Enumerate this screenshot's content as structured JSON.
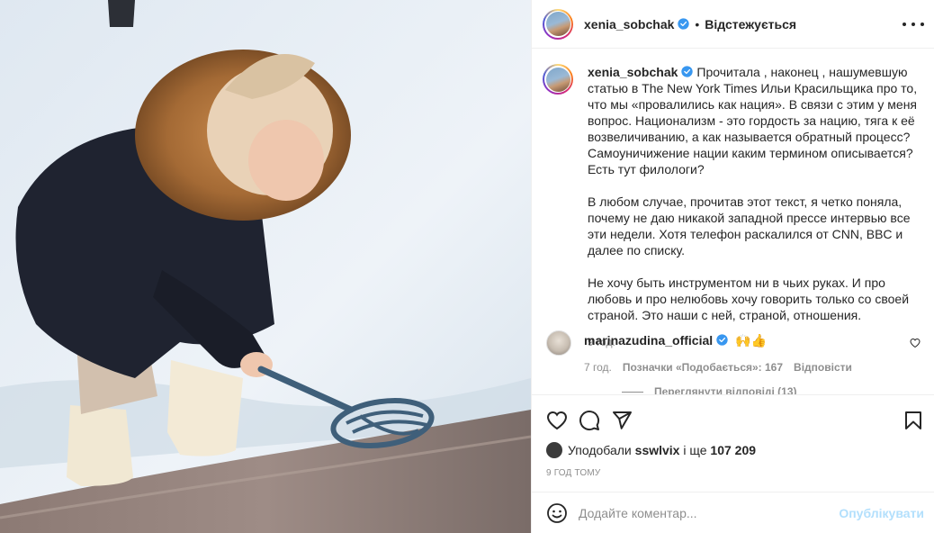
{
  "header": {
    "username": "xenia_sobchak",
    "separator": "•",
    "follow_state": "Відстежується"
  },
  "caption": {
    "username": "xenia_sobchak",
    "paragraph_1": "Прочитала , наконец , нашумевшую статью в The New York Times Ильи Красильщика про то, что мы «провалились как нация». В связи с этим у меня вопрос. Национализм - это гордость за нацию, тяга к её возвеличиванию, а как называется обратный процесс? Самоуничижение нации каким термином описывается? Есть тут филологи?",
    "paragraph_2": "В любом случае, прочитав этот текст, я четко поняла, почему не даю никакой западной прессе интервью все эти недели. Хотя телефон раскалился от CNN, BBC и далее по списку.",
    "paragraph_3": "Не хочу быть инструментом ни в чьих руках. И про любовь и про нелюбовь хочу говорить только со своей страной. Это наши с ней, страной, отношения.",
    "time": "9 год."
  },
  "comment": {
    "username": "marinazudina_official",
    "text": "🙌👍",
    "time": "7 год.",
    "likes": "Позначки «Подобається»: 167",
    "reply": "Відповісти",
    "view_replies": "Переглянути відповіді (13)"
  },
  "actions": {
    "like_icon": "heart-icon",
    "comment_icon": "comment-bubble-icon",
    "share_icon": "paper-plane-icon",
    "save_icon": "bookmark-icon"
  },
  "likes": {
    "prefix": "Уподобали ",
    "user": "sswlvix",
    "middle": " і ще ",
    "count": "107 209"
  },
  "post_time": "9 ГОД ТОМУ",
  "add_comment": {
    "emoji_icon": "smiley-icon",
    "placeholder": "Додайте коментар...",
    "publish": "Опублікувати"
  },
  "colors": {
    "verified": "#3897f0",
    "publish_disabled": "#b2dffc",
    "muted_text": "#8e8e8e",
    "border": "#efefef"
  }
}
